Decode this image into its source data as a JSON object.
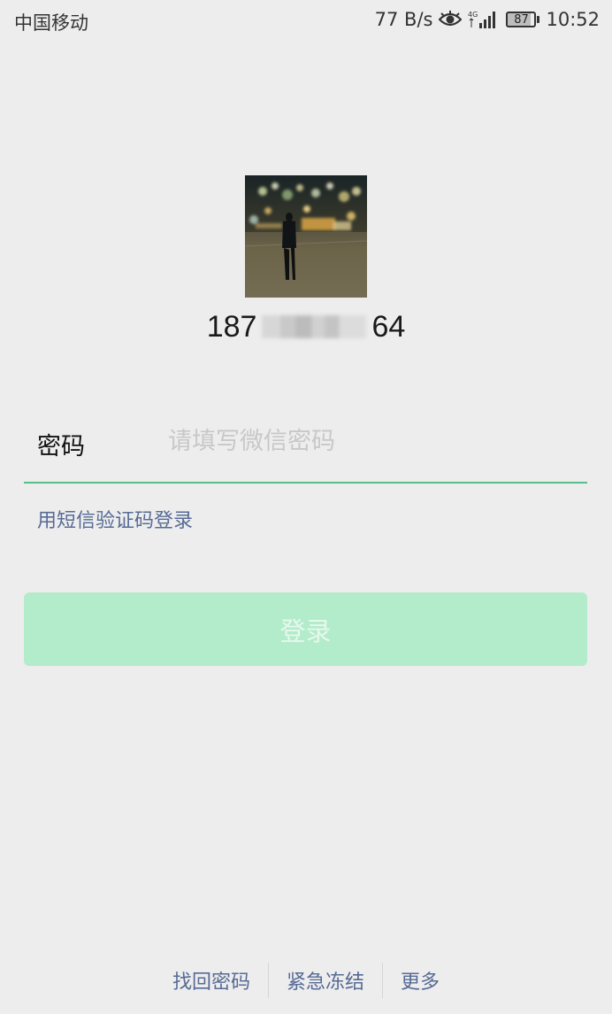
{
  "status_bar": {
    "carrier": "中国移动",
    "net_speed": "77 B/s",
    "network": "4G",
    "battery": "87",
    "time": "10:52"
  },
  "account": {
    "prefix": "187",
    "suffix": "64"
  },
  "login": {
    "password_label": "密码",
    "password_placeholder": "请填写微信密码",
    "sms_login_link": "用短信验证码登录",
    "login_button": "登录"
  },
  "footer": {
    "links": [
      "找回密码",
      "紧急冻结",
      "更多"
    ]
  },
  "colors": {
    "accent": "#57be8c",
    "button_disabled": "#b3ecca",
    "link": "#576b95",
    "background": "#ededed"
  }
}
